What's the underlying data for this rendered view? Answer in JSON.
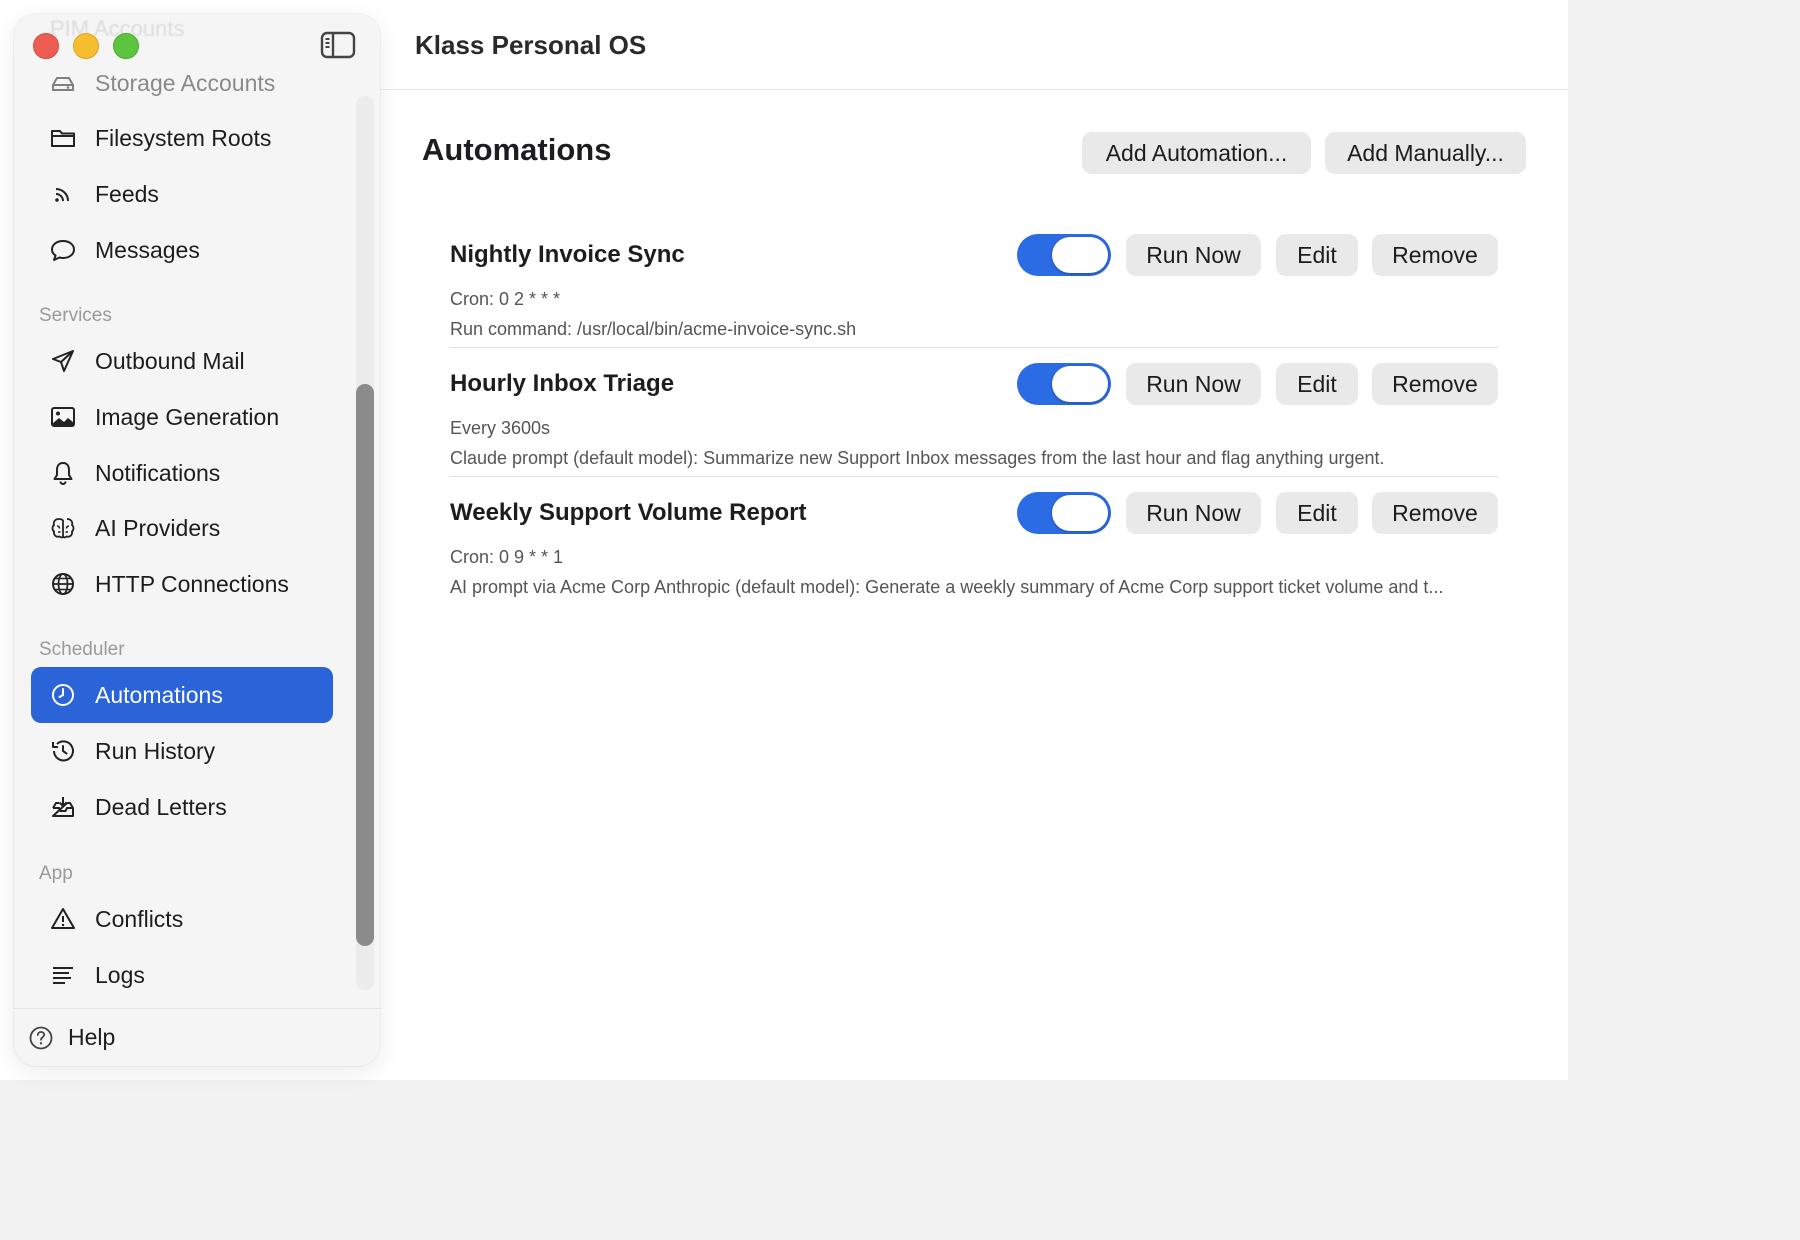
{
  "app_title": "Klass Personal OS",
  "sidebar": {
    "ghost_item": "PIM Accounts",
    "top_items": [
      {
        "label": "Storage Accounts",
        "icon": "storage-icon"
      },
      {
        "label": "Filesystem Roots",
        "icon": "folder-icon"
      },
      {
        "label": "Feeds",
        "icon": "rss-icon"
      },
      {
        "label": "Messages",
        "icon": "message-bubble-icon"
      }
    ],
    "sections": {
      "services": "Services",
      "scheduler": "Scheduler",
      "app": "App"
    },
    "services_items": [
      {
        "label": "Outbound Mail",
        "icon": "paper-plane-icon"
      },
      {
        "label": "Image Generation",
        "icon": "image-icon"
      },
      {
        "label": "Notifications",
        "icon": "bell-icon"
      },
      {
        "label": "AI Providers",
        "icon": "brain-icon"
      },
      {
        "label": "HTTP Connections",
        "icon": "globe-icon"
      }
    ],
    "scheduler_items": [
      {
        "label": "Automations",
        "icon": "clock-icon",
        "active": true
      },
      {
        "label": "Run History",
        "icon": "history-icon"
      },
      {
        "label": "Dead Letters",
        "icon": "inbox-tray-icon"
      }
    ],
    "app_items": [
      {
        "label": "Conflicts",
        "icon": "warning-icon"
      },
      {
        "label": "Logs",
        "icon": "lines-icon"
      }
    ],
    "help_label": "Help"
  },
  "main": {
    "title": "Automations",
    "add_automation_label": "Add Automation...",
    "add_manually_label": "Add Manually...",
    "automations": [
      {
        "name": "Nightly Invoice Sync",
        "schedule": "Cron: 0 2 * * *",
        "description": "Run command: /usr/local/bin/acme-invoice-sync.sh",
        "enabled": true
      },
      {
        "name": "Hourly Inbox Triage",
        "schedule": "Every 3600s",
        "description": "Claude prompt (default model): Summarize new Support Inbox messages from the last hour and flag anything urgent.",
        "enabled": true
      },
      {
        "name": "Weekly Support Volume Report",
        "schedule": "Cron: 0 9 * * 1",
        "description": "AI prompt via Acme Corp Anthropic (default model): Generate a weekly summary of Acme Corp support ticket volume and t...",
        "enabled": true
      }
    ],
    "row_buttons": {
      "run_now": "Run Now",
      "edit": "Edit",
      "remove": "Remove"
    }
  },
  "colors": {
    "accent": "#2b63d9",
    "toggle_on": "#2b6be3"
  }
}
